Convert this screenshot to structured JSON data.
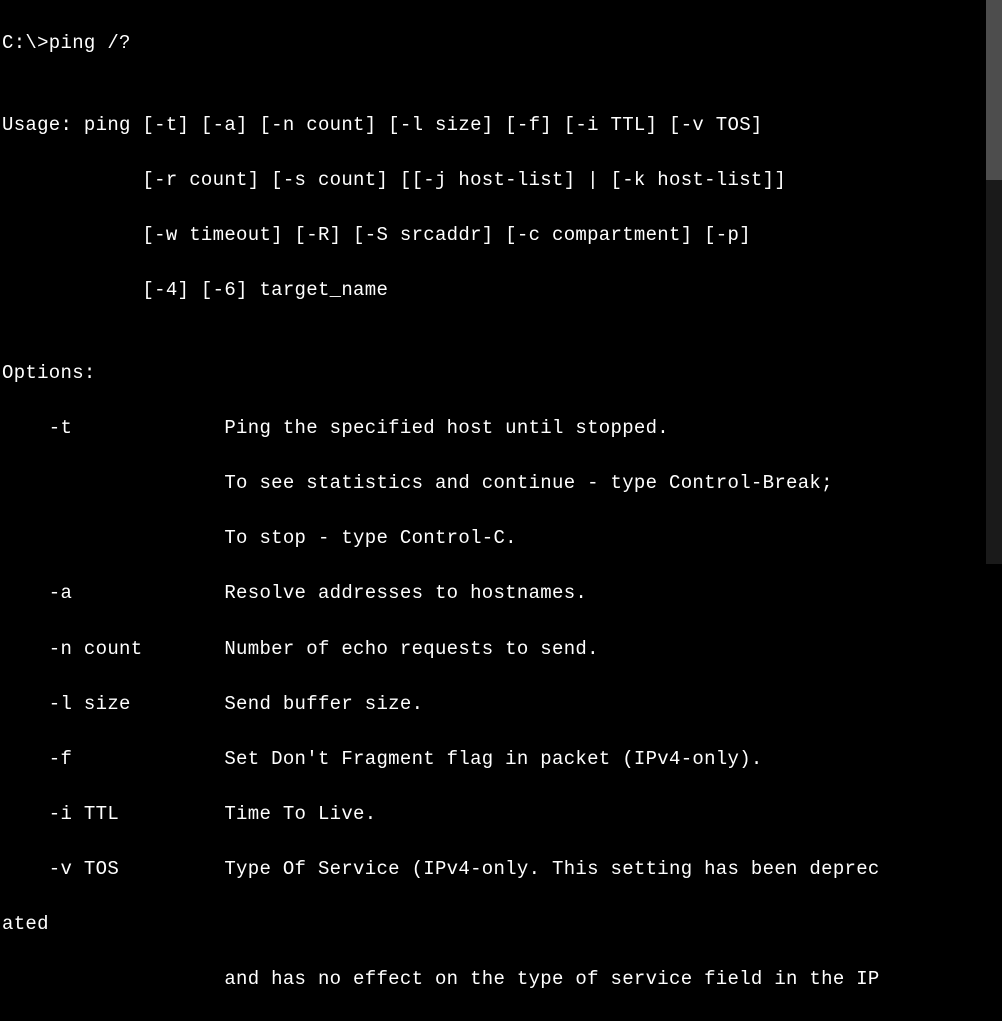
{
  "prompt": "C:\\>ping /?",
  "blank1": "",
  "usage1": "Usage: ping [-t] [-a] [-n count] [-l size] [-f] [-i TTL] [-v TOS]",
  "usage2": "            [-r count] [-s count] [[-j host-list] | [-k host-list]]",
  "usage3": "            [-w timeout] [-R] [-S srcaddr] [-c compartment] [-p]",
  "usage4": "            [-4] [-6] target_name",
  "blank2": "",
  "optionsHeader": "Options:",
  "opt_t1": "    -t             Ping the specified host until stopped.",
  "opt_t2": "                   To see statistics and continue - type Control-Break;",
  "opt_t3": "                   To stop - type Control-C.",
  "opt_a": "    -a             Resolve addresses to hostnames.",
  "opt_n": "    -n count       Number of echo requests to send.",
  "opt_l": "    -l size        Send buffer size.",
  "opt_f": "    -f             Set Don't Fragment flag in packet (IPv4-only).",
  "opt_i": "    -i TTL         Time To Live.",
  "opt_v1": "    -v TOS         Type Of Service (IPv4-only. This setting has been deprec",
  "opt_v1b": "ated",
  "opt_v2": "                   and has no effect on the type of service field in the IP"
}
